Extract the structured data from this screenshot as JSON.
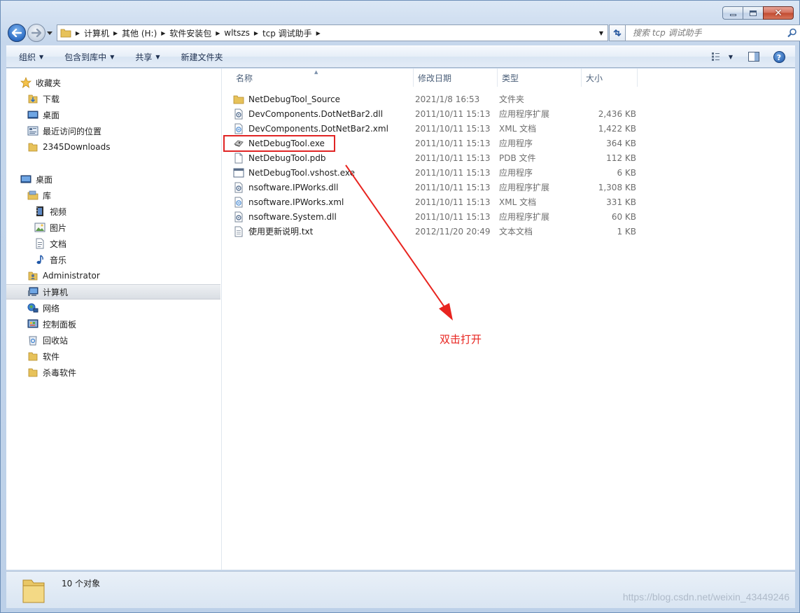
{
  "window": {
    "minimize_label": "",
    "maximize_label": "",
    "close_label": ""
  },
  "navigation": {
    "breadcrumbs": [
      "计算机",
      "其他 (H:)",
      "软件安装包",
      "wltszs",
      "tcp 调试助手"
    ],
    "search_placeholder": "搜索 tcp 调试助手"
  },
  "toolbar": {
    "organize": "组织",
    "include_in_library": "包含到库中",
    "share": "共享",
    "new_folder": "新建文件夹"
  },
  "sidebar": {
    "favorites": {
      "label": "收藏夹",
      "items": [
        "下载",
        "桌面",
        "最近访问的位置",
        "2345Downloads"
      ]
    },
    "desktop": {
      "label": "桌面",
      "library": {
        "label": "库",
        "items": [
          "视频",
          "图片",
          "文档",
          "音乐"
        ]
      },
      "items": [
        "Administrator",
        "计算机",
        "网络",
        "控制面板",
        "回收站",
        "软件",
        "杀毒软件"
      ],
      "selected": "计算机"
    }
  },
  "columns": {
    "name": "名称",
    "date": "修改日期",
    "type": "类型",
    "size": "大小"
  },
  "files": [
    {
      "name": "NetDebugTool_Source",
      "date": "2021/1/8 16:53",
      "type": "文件夹",
      "size": "",
      "icon": "folder-icon"
    },
    {
      "name": "DevComponents.DotNetBar2.dll",
      "date": "2011/10/11 15:13",
      "type": "应用程序扩展",
      "size": "2,436 KB",
      "icon": "dll-file-icon"
    },
    {
      "name": "DevComponents.DotNetBar2.xml",
      "date": "2011/10/11 15:13",
      "type": "XML 文档",
      "size": "1,422 KB",
      "icon": "xml-file-icon"
    },
    {
      "name": "NetDebugTool.exe",
      "date": "2011/10/11 15:13",
      "type": "应用程序",
      "size": "364 KB",
      "icon": "exe-app-icon"
    },
    {
      "name": "NetDebugTool.pdb",
      "date": "2011/10/11 15:13",
      "type": "PDB 文件",
      "size": "112 KB",
      "icon": "blank-file-icon"
    },
    {
      "name": "NetDebugTool.vshost.exe",
      "date": "2011/10/11 15:13",
      "type": "应用程序",
      "size": "6 KB",
      "icon": "window-exe-icon"
    },
    {
      "name": "nsoftware.IPWorks.dll",
      "date": "2011/10/11 15:13",
      "type": "应用程序扩展",
      "size": "1,308 KB",
      "icon": "dll-file-icon"
    },
    {
      "name": "nsoftware.IPWorks.xml",
      "date": "2011/10/11 15:13",
      "type": "XML 文档",
      "size": "331 KB",
      "icon": "xml-file-icon"
    },
    {
      "name": "nsoftware.System.dll",
      "date": "2011/10/11 15:13",
      "type": "应用程序扩展",
      "size": "60 KB",
      "icon": "dll-file-icon"
    },
    {
      "name": "使用更新说明.txt",
      "date": "2012/11/20 20:49",
      "type": "文本文档",
      "size": "1 KB",
      "icon": "text-file-icon"
    }
  ],
  "annotation": {
    "text": "双击打开",
    "color": "#e8241f"
  },
  "status": {
    "count": "10 个对象"
  },
  "watermark": "https://blog.csdn.net/weixin_43449246"
}
